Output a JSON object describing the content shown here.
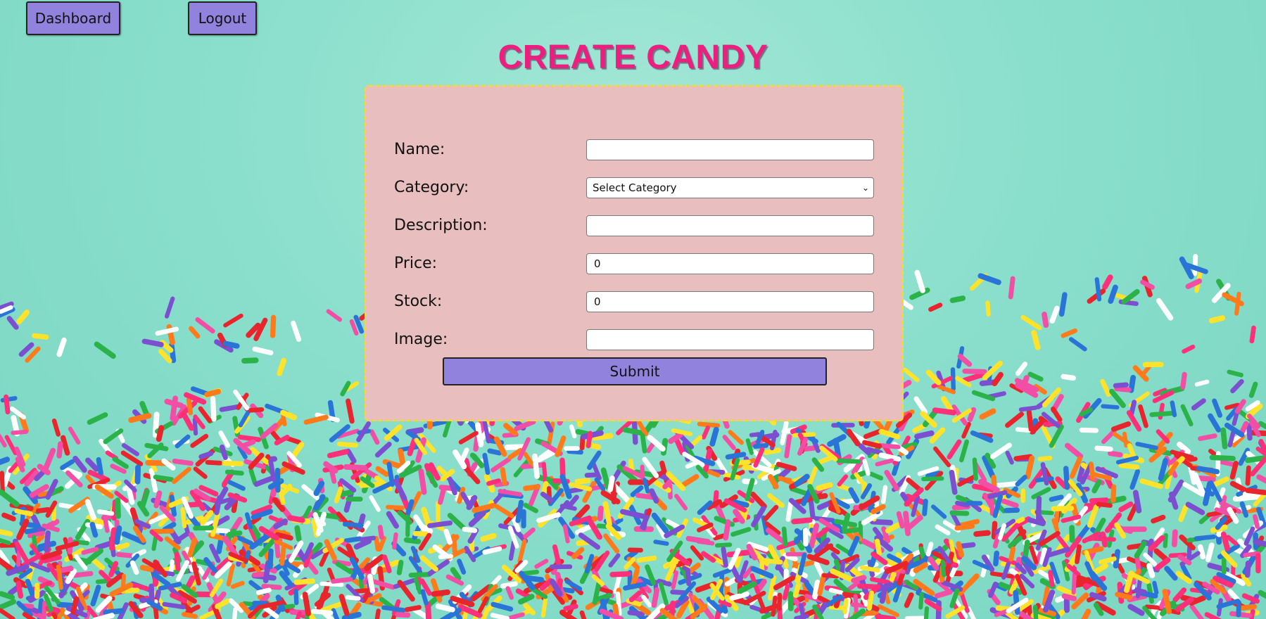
{
  "nav": {
    "dashboard_label": "Dashboard",
    "logout_label": "Logout"
  },
  "page": {
    "title": "CREATE CANDY"
  },
  "form": {
    "name": {
      "label": "Name:",
      "value": ""
    },
    "category": {
      "label": "Category:",
      "selected": "Select Category"
    },
    "description": {
      "label": "Description:",
      "value": ""
    },
    "price": {
      "label": "Price:",
      "value": "0"
    },
    "stock": {
      "label": "Stock:",
      "value": "0"
    },
    "image": {
      "label": "Image:",
      "value": ""
    },
    "submit_label": "Submit"
  },
  "colors": {
    "background": "#7fd9c6",
    "button": "#9182de",
    "title": "#ec1e80",
    "panel": "#e8bfbe",
    "panel_border": "#f4e200"
  },
  "background_image": "sprinkles"
}
